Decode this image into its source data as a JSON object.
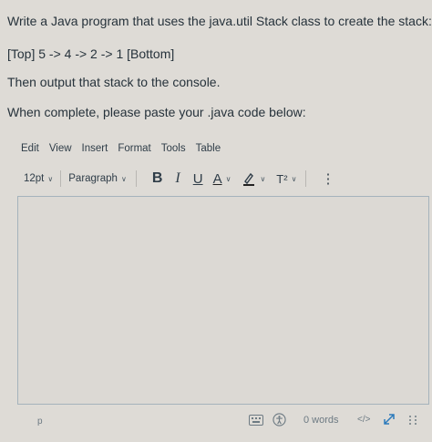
{
  "question": {
    "line1": "Write a Java program that uses the java.util Stack class to create the stack:",
    "line2": "[Top] 5 -> 4 -> 2 -> 1 [Bottom]",
    "line3": "Then output that stack to the console.",
    "line4": "When complete, please paste your .java code below:"
  },
  "menubar": {
    "items": [
      "Edit",
      "View",
      "Insert",
      "Format",
      "Tools",
      "Table"
    ]
  },
  "toolbar": {
    "font_size": "12pt",
    "block_format": "Paragraph",
    "bold": "B",
    "italic": "I",
    "underline": "U",
    "text_color": "A",
    "superscript": "T²",
    "more": "⋮"
  },
  "editor": {
    "content": ""
  },
  "statusbar": {
    "path": "p",
    "word_count": "0 words",
    "html_toggle": "</>"
  },
  "colors": {
    "background": "#dedbd6",
    "editor_border": "#a5b3bc",
    "toolbar_text": "#2f3d48",
    "icon_blue": "#2b7abc"
  }
}
